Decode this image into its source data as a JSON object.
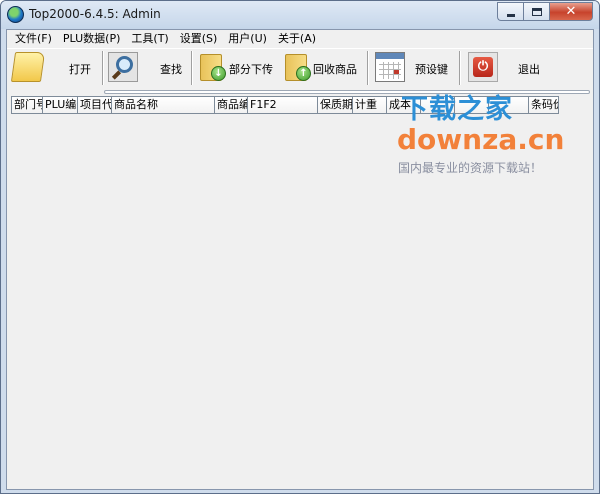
{
  "window": {
    "title": "Top2000-6.4.5: Admin"
  },
  "titlebar_buttons": {
    "close_glyph": "✕"
  },
  "menu": [
    {
      "label": "文件(F)"
    },
    {
      "label": "PLU数据(P)"
    },
    {
      "label": "工具(T)"
    },
    {
      "label": "设置(S)"
    },
    {
      "label": "用户(U)"
    },
    {
      "label": "关于(A)"
    }
  ],
  "toolbar": {
    "open_label": "打开",
    "find_label": "查找",
    "partial_upload_label": "部分下传",
    "recycle_label": "回收商品",
    "preset_keys_label": "预设键",
    "exit_label": "退出",
    "icons": {
      "open": "folder-open-icon",
      "find": "magnifier-icon",
      "partial_upload": "folder-download-icon",
      "recycle": "folder-upload-icon",
      "preset_keys": "calendar-icon",
      "exit": "power-icon"
    }
  },
  "table": {
    "columns": [
      "部门号",
      "PLU编号",
      "项目代",
      "商品名称",
      "商品编",
      "F1F2",
      "保质期",
      "计重",
      "成本",
      "",
      "",
      "",
      "条码价"
    ]
  },
  "watermark": {
    "title": "下载之家",
    "url": "downza.cn",
    "slogan": "国内最专业的资源下载站！"
  },
  "colors": {
    "client_bg": "#f0f0f0",
    "frame": "#cfdcec",
    "close_red": "#c7432c",
    "wm_blue": "#2c8fd6",
    "wm_orange": "#f2813a"
  }
}
